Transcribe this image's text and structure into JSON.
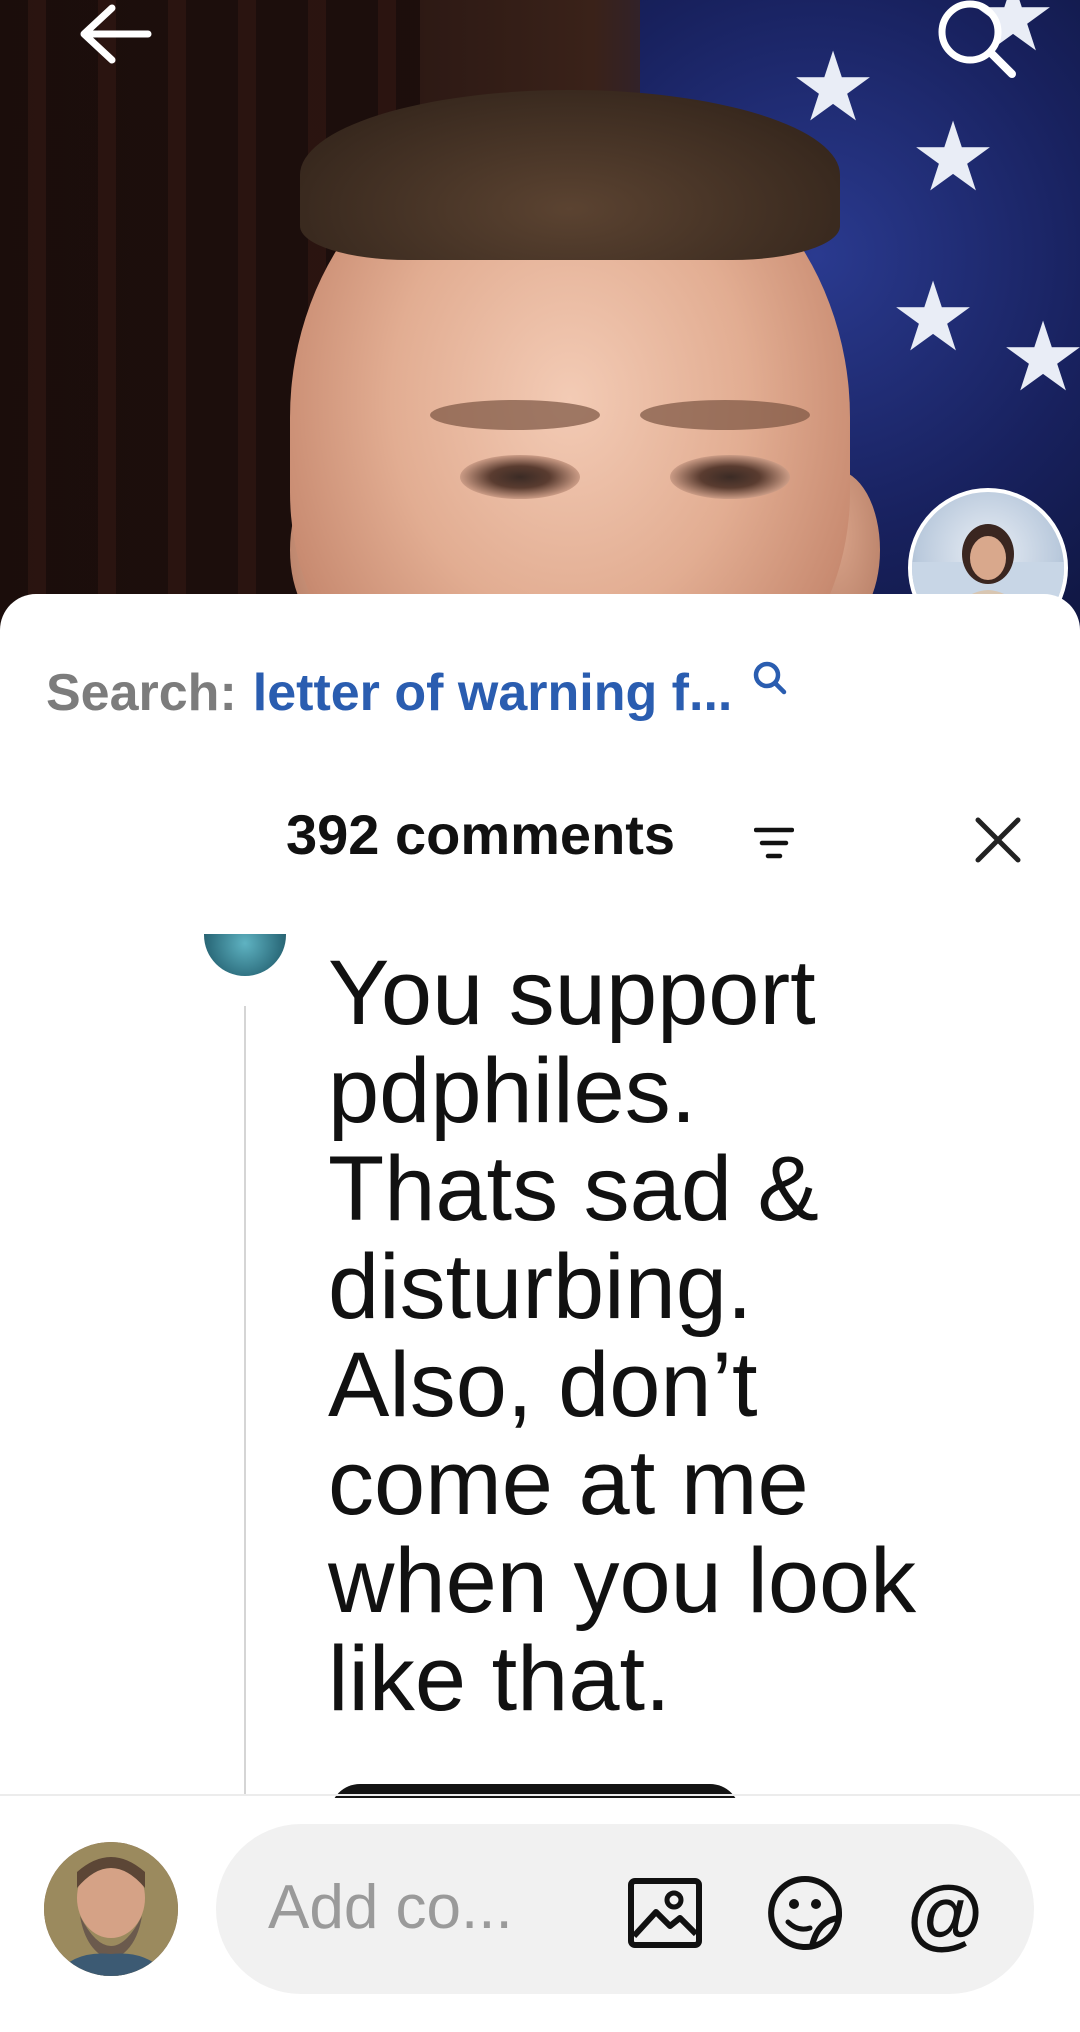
{
  "search": {
    "label": "Search:",
    "query": "letter of warning f..."
  },
  "comments": {
    "count_label": "392 comments",
    "items": [
      {
        "text": "You support\npdphiles.\nThats sad &\ndisturbing.\nAlso, don’t\ncome at me\nwhen you look\nlike that."
      }
    ]
  },
  "composer": {
    "placeholder": "Add co..."
  },
  "icons": {
    "back": "back-arrow-icon",
    "search": "search-icon",
    "sort": "sort-icon",
    "close": "close-icon",
    "photo": "image-icon",
    "sticker": "sticker-icon",
    "mention": "@"
  },
  "colors": {
    "search_query": "#2a5db0",
    "search_label": "#7c7c7c",
    "sheet_bg": "#ffffff",
    "input_bg": "#f1f1f1"
  }
}
